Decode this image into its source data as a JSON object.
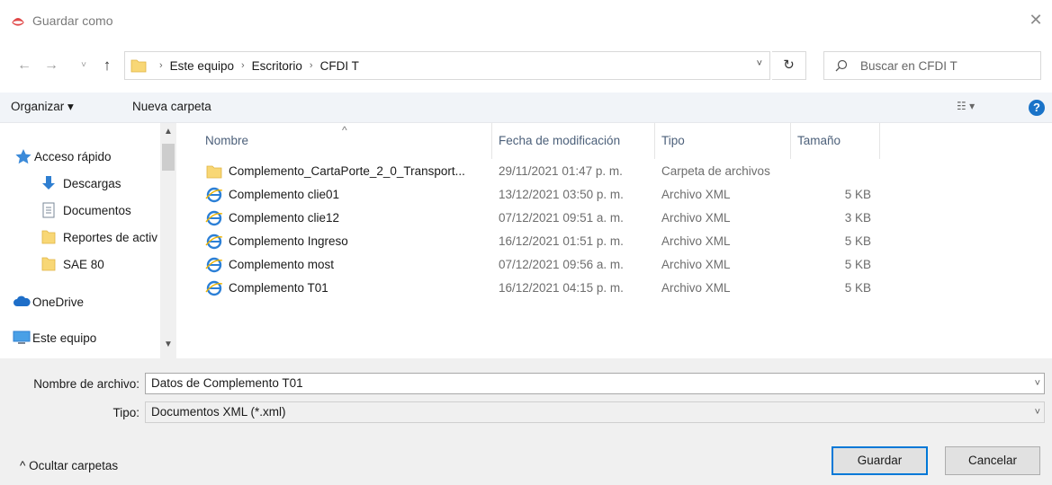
{
  "window": {
    "title": "Guardar como",
    "close_glyph": "✕"
  },
  "nav": {
    "back": "←",
    "forward": "→",
    "recent": "˅",
    "up": "↑"
  },
  "address": {
    "breadcrumbs": [
      "Este equipo",
      "Escritorio",
      "CFDI T"
    ],
    "separator": "›",
    "dropdown_glyph": "˅",
    "refresh_glyph": "↻"
  },
  "search": {
    "placeholder": "Buscar en CFDI T"
  },
  "toolbar": {
    "organize_label": "Organizar ▾",
    "new_folder_label": "Nueva carpeta",
    "view_glyph": "☷ ▾",
    "help_glyph": "?"
  },
  "sidebar": {
    "items": [
      {
        "label": "Acceso rápido",
        "icon": "star-icon"
      },
      {
        "label": "Descargas",
        "icon": "download-icon"
      },
      {
        "label": "Documentos",
        "icon": "document-icon"
      },
      {
        "label": "Reportes de activ",
        "icon": "folder-icon"
      },
      {
        "label": "SAE 80",
        "icon": "folder-icon"
      },
      {
        "label": "OneDrive",
        "icon": "cloud-icon"
      },
      {
        "label": "Este equipo",
        "icon": "computer-icon"
      }
    ]
  },
  "columns": {
    "name": "Nombre",
    "date": "Fecha de modificación",
    "type": "Tipo",
    "size": "Tamaño"
  },
  "files": [
    {
      "name": "Complemento_CartaPorte_2_0_Transport...",
      "date": "29/11/2021 01:47 p. m.",
      "type": "Carpeta de archivos",
      "size": "",
      "icon": "folder-icon"
    },
    {
      "name": "Complemento clie01",
      "date": "13/12/2021 03:50 p. m.",
      "type": "Archivo XML",
      "size": "5 KB",
      "icon": "ie-xml-icon"
    },
    {
      "name": "Complemento clie12",
      "date": "07/12/2021 09:51 a. m.",
      "type": "Archivo XML",
      "size": "3 KB",
      "icon": "ie-xml-icon"
    },
    {
      "name": "Complemento Ingreso",
      "date": "16/12/2021 01:51 p. m.",
      "type": "Archivo XML",
      "size": "5 KB",
      "icon": "ie-xml-icon"
    },
    {
      "name": "Complemento most",
      "date": "07/12/2021 09:56 a. m.",
      "type": "Archivo XML",
      "size": "5 KB",
      "icon": "ie-xml-icon"
    },
    {
      "name": "Complemento T01",
      "date": "16/12/2021 04:15 p. m.",
      "type": "Archivo XML",
      "size": "5 KB",
      "icon": "ie-xml-icon"
    }
  ],
  "form": {
    "filename_label": "Nombre de archivo:",
    "filename_value": "Datos de Complemento T01",
    "type_label": "Tipo:",
    "type_value": "Documentos XML (*.xml)",
    "combo_arrow": "˅"
  },
  "footer": {
    "hide_folders_label": "^  Ocultar carpetas",
    "save_label": "Guardar",
    "cancel_label": "Cancelar"
  },
  "colors": {
    "accent": "#0078d7",
    "folder": "#f8d775",
    "header_text": "#4c607a"
  }
}
